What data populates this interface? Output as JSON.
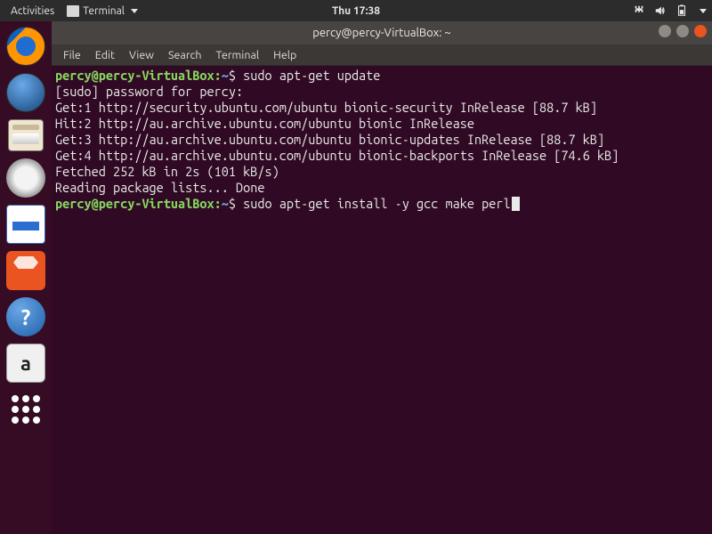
{
  "topbar": {
    "activities": "Activities",
    "app_label": "Terminal",
    "clock": "Thu 17:38"
  },
  "launcher": [
    {
      "name": "firefox"
    },
    {
      "name": "thunderbird"
    },
    {
      "name": "files"
    },
    {
      "name": "rhythmbox"
    },
    {
      "name": "writer"
    },
    {
      "name": "software"
    },
    {
      "name": "help"
    },
    {
      "name": "amazon"
    },
    {
      "name": "show-apps"
    }
  ],
  "window": {
    "title": "percy@percy-VirtualBox: ~",
    "menus": [
      "File",
      "Edit",
      "View",
      "Search",
      "Terminal",
      "Help"
    ]
  },
  "terminal": {
    "user_host": "percy@percy-VirtualBox:",
    "cwd": "~",
    "dollar": "$",
    "cmd1": "sudo apt-get update",
    "line2": "[sudo] password for percy:",
    "line3": "Get:1 http://security.ubuntu.com/ubuntu bionic-security InRelease [88.7 kB]",
    "line4": "Hit:2 http://au.archive.ubuntu.com/ubuntu bionic InRelease",
    "line5": "Get:3 http://au.archive.ubuntu.com/ubuntu bionic-updates InRelease [88.7 kB]",
    "line6": "Get:4 http://au.archive.ubuntu.com/ubuntu bionic-backports InRelease [74.6 kB]",
    "line7": "Fetched 252 kB in 2s (101 kB/s)",
    "line8": "Reading package lists... Done",
    "cmd2": "sudo apt-get install -y gcc make perl"
  }
}
